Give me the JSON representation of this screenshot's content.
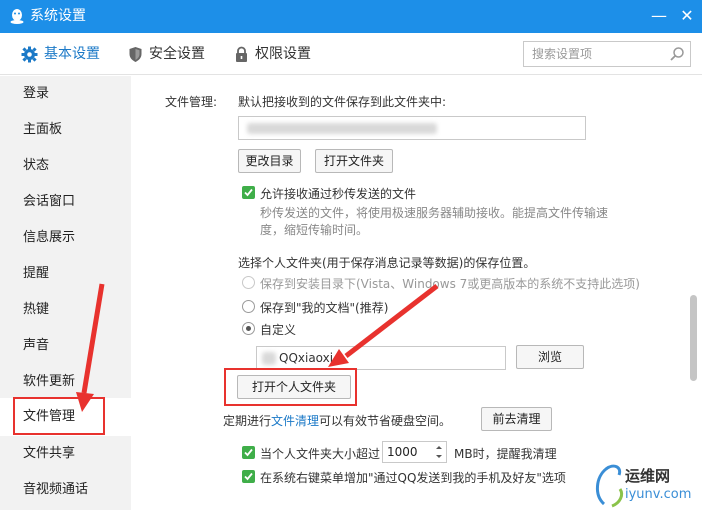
{
  "window": {
    "title": "系统设置",
    "minimize_glyph": "—",
    "close_glyph": "✕"
  },
  "tabs": [
    {
      "label": "基本设置",
      "icon": "gear-icon"
    },
    {
      "label": "安全设置",
      "icon": "shield-icon"
    },
    {
      "label": "权限设置",
      "icon": "lock-icon"
    }
  ],
  "search": {
    "placeholder": "搜索设置项"
  },
  "sidebar": {
    "items": [
      "登录",
      "主面板",
      "状态",
      "会话窗口",
      "信息展示",
      "提醒",
      "热键",
      "声音",
      "软件更新",
      "文件管理",
      "文件共享",
      "音视频通话"
    ],
    "active_index": 9
  },
  "file_mgmt": {
    "section_label": "文件管理:",
    "save_path_label": "默认把接收到的文件保存到此文件夹中:",
    "change_dir_button": "更改目录",
    "open_folder_button": "打开文件夹",
    "allow_flash_checkbox": "允许接收通过秒传发送的文件",
    "flash_desc_line1": "秒传发送的文件，将使用极速服务器辅助接收。能提高文件传输速",
    "flash_desc_line2": "度，缩短传输时间。"
  },
  "personal_folder": {
    "prompt": "选择个人文件夹(用于保存消息记录等数据)的保存位置。",
    "option_install": "保存到安装目录下(Vista、Windows 7或更高版本的系统不支持此选项)",
    "option_mydocs": "保存到\"我的文档\"(推荐)",
    "option_custom": "自定义",
    "custom_path": "QQxiaoxi",
    "browse_button": "浏览",
    "open_personal_button": "打开个人文件夹"
  },
  "cleanup": {
    "text_before": "定期进行",
    "link": "文件清理",
    "text_after": "可以有效节省硬盘空间。",
    "button": "前去清理"
  },
  "size_warn": {
    "label_before": "当个人文件夹大小超过",
    "value": "1000",
    "label_after": "MB时，提醒我清理"
  },
  "context_menu": {
    "label": "在系统右键菜单增加\"通过QQ发送到我的手机及好友\"选项"
  },
  "watermark": {
    "text_cn": "运维网",
    "text_en": "iyunv.com"
  },
  "colors": {
    "titlebar": "#1d8fe8",
    "accent": "#1b79c7",
    "check": "#3fae49",
    "annotation": "#e8322e"
  }
}
